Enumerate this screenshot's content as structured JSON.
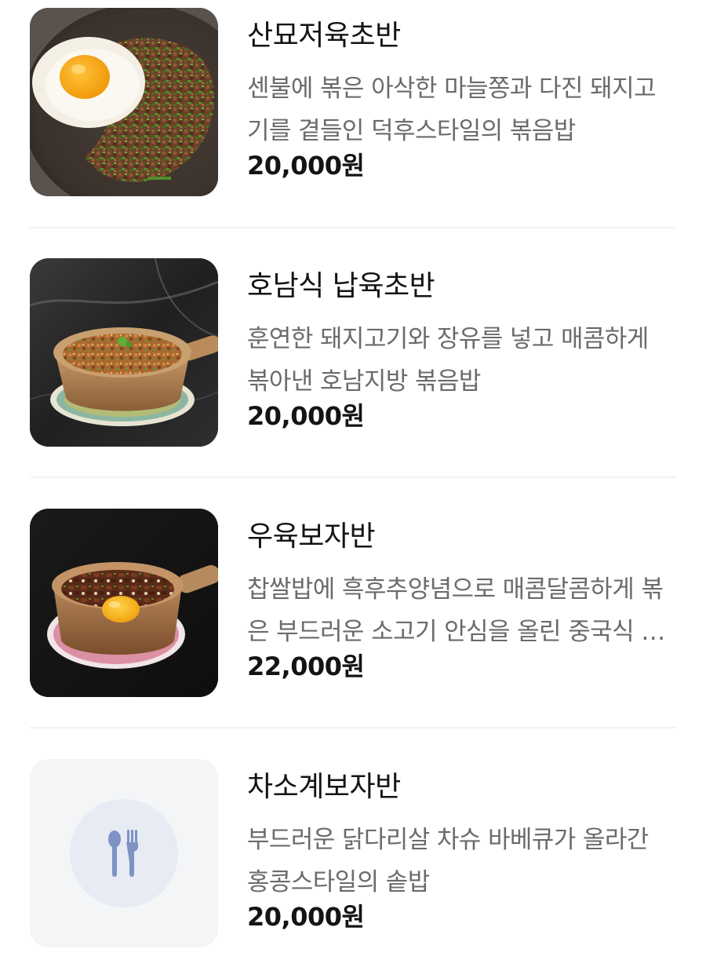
{
  "menu": {
    "items": [
      {
        "name": "산묘저육초반",
        "description": "센불에 볶은 아삭한 마늘쫑과 다진 돼지고기를 곁들인 덕후스타일의 볶음밥",
        "price": "20,000원",
        "image": "fried-rice-with-fried-egg-photo"
      },
      {
        "name": "호남식 납육초반",
        "description": "훈연한 돼지고기와 장유를 넣고 매콤하게 볶아낸 호남지방 볶음밥",
        "price": "20,000원",
        "image": "claypot-fried-rice-photo"
      },
      {
        "name": "우육보자반",
        "description": "찹쌀밥에 흑후추양념으로 매콤달콤하게 볶은 부드러운 소고기 안심을 올린 중국식 솥밥",
        "price": "22,000원",
        "image": "beef-claypot-rice-with-egg-yolk-photo"
      },
      {
        "name": "차소계보자반",
        "description": "부드러운 닭다리살 차슈 바베큐가 올라간 홍콩스타일의 솥밥",
        "price": "20,000원",
        "image": "spoon-fork-icon"
      }
    ]
  }
}
